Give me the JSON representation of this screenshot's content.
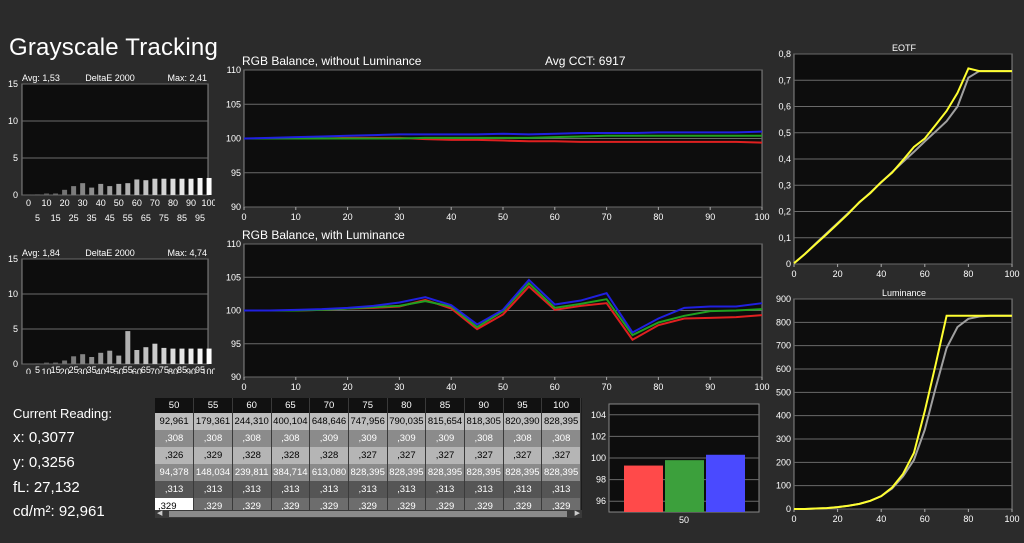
{
  "page": {
    "title": "Grayscale Tracking"
  },
  "readout": {
    "label": "Current Reading:",
    "x": "x: 0,3077",
    "y": "y: 0,3256",
    "fl": "fL: 27,132",
    "cdm2": "cd/m²: 92,961"
  },
  "colors": {
    "background": "#2b2b2b",
    "plot_bg": "#0d0d0d",
    "grid": "#6a6a6a",
    "red": "#e02020",
    "green": "#20a020",
    "blue": "#2020e0",
    "yellow": "#ffff30",
    "gray_line": "#a0a0a0"
  },
  "table": {
    "headers": [
      "50",
      "55",
      "60",
      "65",
      "70",
      "75",
      "80",
      "85",
      "90",
      "95",
      "100"
    ],
    "rows": [
      [
        "92,961",
        "179,361",
        "244,310",
        "400,104",
        "648,646",
        "747,956",
        "790,035",
        "815,654",
        "818,305",
        "820,390",
        "828,395"
      ],
      [
        ",308",
        ",308",
        ",308",
        ",308",
        ",309",
        ",309",
        ",309",
        ",309",
        ",308",
        ",308",
        ",308"
      ],
      [
        ",326",
        ",329",
        ",328",
        ",328",
        ",328",
        ",327",
        ",327",
        ",327",
        ",327",
        ",327",
        ",327"
      ],
      [
        "94,378",
        "148,034",
        "239,811",
        "384,714",
        "613,080",
        "828,395",
        "828,395",
        "828,395",
        "828,395",
        "828,395",
        "828,395"
      ],
      [
        ",313",
        ",313",
        ",313",
        ",313",
        ",313",
        ",313",
        ",313",
        ",313",
        ",313",
        ",313",
        ",313"
      ],
      [
        ",329",
        ",329",
        ",329",
        ",329",
        ",329",
        ",329",
        ",329",
        ",329",
        ",329",
        ",329",
        ",329"
      ]
    ],
    "scroll_left": "◀",
    "scroll_right": "▶"
  },
  "chart_data": [
    {
      "id": "delta-e-top",
      "type": "bar",
      "title": "DeltaE 2000",
      "avg_label": "Avg: 1,53",
      "max_label": "Max: 2,41",
      "categories": [
        0,
        5,
        10,
        15,
        20,
        25,
        30,
        35,
        40,
        45,
        50,
        55,
        60,
        65,
        70,
        75,
        80,
        85,
        90,
        95,
        100
      ],
      "values": [
        0.1,
        0.1,
        0.2,
        0.2,
        0.7,
        1.2,
        1.6,
        1.0,
        1.5,
        1.2,
        1.5,
        1.6,
        2.1,
        2.0,
        2.2,
        2.2,
        2.2,
        2.2,
        2.2,
        2.3,
        2.3
      ],
      "ylim": [
        0,
        15
      ],
      "yticks": [
        0,
        5,
        10,
        15
      ],
      "xticks_upper": [
        "0",
        "10",
        "20",
        "30",
        "40",
        "50",
        "60",
        "70",
        "80",
        "90",
        "100"
      ],
      "xticks_lower": [
        "5",
        "15",
        "25",
        "35",
        "45",
        "55",
        "65",
        "75",
        "85",
        "95"
      ]
    },
    {
      "id": "delta-e-bottom",
      "type": "bar",
      "title": "DeltaE 2000",
      "avg_label": "Avg: 1,84",
      "max_label": "Max: 4,74",
      "categories": [
        0,
        5,
        10,
        15,
        20,
        25,
        30,
        35,
        40,
        45,
        50,
        55,
        60,
        65,
        70,
        75,
        80,
        85,
        90,
        95,
        100
      ],
      "values": [
        0.1,
        0.1,
        0.2,
        0.2,
        0.5,
        1.1,
        1.4,
        1.0,
        1.6,
        1.9,
        1.2,
        4.7,
        2.0,
        2.4,
        2.9,
        2.3,
        2.2,
        2.2,
        2.2,
        2.2,
        2.2
      ],
      "ylim": [
        0,
        15
      ],
      "yticks": [
        0,
        5,
        10,
        15
      ],
      "xticks": [
        "0",
        "10",
        "20",
        "30",
        "40",
        "50",
        "60",
        "70",
        "80",
        "90",
        "100"
      ],
      "xticks_mid": [
        "5",
        "15",
        "25",
        "35",
        "45",
        "55",
        "65",
        "75",
        "85",
        "95"
      ]
    },
    {
      "id": "rgb-balance-no-lum",
      "type": "line",
      "title": "RGB Balance, without Luminance",
      "extra_label": "Avg CCT: 6917",
      "x": [
        0,
        5,
        10,
        15,
        20,
        25,
        30,
        35,
        40,
        45,
        50,
        55,
        60,
        65,
        70,
        75,
        80,
        85,
        90,
        95,
        100
      ],
      "series": [
        {
          "color": "red",
          "values": [
            100,
            100,
            100,
            100,
            100.1,
            100.1,
            100.1,
            99.9,
            99.8,
            99.8,
            99.7,
            99.6,
            99.6,
            99.5,
            99.5,
            99.5,
            99.5,
            99.5,
            99.5,
            99.5,
            99.4
          ]
        },
        {
          "color": "green",
          "values": [
            100,
            100,
            100,
            100,
            100,
            100,
            100,
            100.1,
            100.1,
            100.1,
            100.1,
            100.1,
            100.2,
            100.3,
            100.4,
            100.4,
            100.4,
            100.4,
            100.4,
            100.4,
            100.4
          ]
        },
        {
          "color": "blue",
          "values": [
            100,
            100.1,
            100.2,
            100.3,
            100.4,
            100.5,
            100.6,
            100.6,
            100.6,
            100.6,
            100.7,
            100.6,
            100.7,
            100.8,
            100.8,
            100.8,
            100.9,
            100.9,
            100.9,
            100.9,
            101.0
          ]
        }
      ],
      "xlim": [
        0,
        100
      ],
      "ylim": [
        90,
        110
      ],
      "xticks": [
        0,
        10,
        20,
        30,
        40,
        50,
        60,
        70,
        80,
        90,
        100
      ],
      "yticks": [
        90,
        95,
        100,
        105,
        110
      ]
    },
    {
      "id": "rgb-balance-lum",
      "type": "line",
      "title": "RGB Balance, with Luminance",
      "x": [
        0,
        5,
        10,
        15,
        20,
        25,
        30,
        35,
        40,
        45,
        50,
        55,
        60,
        65,
        70,
        75,
        80,
        85,
        90,
        95,
        100
      ],
      "series": [
        {
          "color": "red",
          "values": [
            100,
            100,
            100,
            100.1,
            100.3,
            100.4,
            100.6,
            101.6,
            100.3,
            97.2,
            99.4,
            103.6,
            100.1,
            100.7,
            101.1,
            95.6,
            97.8,
            98.8,
            98.9,
            99.0,
            99.3
          ]
        },
        {
          "color": "green",
          "values": [
            100,
            100,
            100,
            100.1,
            100.3,
            100.5,
            100.7,
            101.4,
            100.6,
            97.5,
            99.9,
            104.1,
            100.4,
            101.0,
            101.7,
            96.3,
            98.2,
            99.2,
            99.9,
            100.0,
            100.2
          ]
        },
        {
          "color": "blue",
          "values": [
            100,
            100,
            100.1,
            100.2,
            100.4,
            100.7,
            101.2,
            102.0,
            100.8,
            97.9,
            100.1,
            104.6,
            100.9,
            101.5,
            102.6,
            96.7,
            98.8,
            100.4,
            100.6,
            100.6,
            101.1
          ]
        }
      ],
      "xlim": [
        0,
        100
      ],
      "ylim": [
        90,
        110
      ],
      "xticks": [
        0,
        10,
        20,
        30,
        40,
        50,
        60,
        70,
        80,
        90,
        100
      ],
      "yticks": [
        90,
        95,
        100,
        105,
        110
      ]
    },
    {
      "id": "rgb-bars",
      "type": "bar",
      "categories": [
        "50"
      ],
      "series": [
        {
          "color": "red",
          "value": 99.3
        },
        {
          "color": "green",
          "value": 99.8
        },
        {
          "color": "blue",
          "value": 100.3
        }
      ],
      "ylim": [
        95,
        105
      ],
      "yticks": [
        96,
        98,
        100,
        102,
        104
      ],
      "xlabel": "50"
    },
    {
      "id": "eotf",
      "type": "line",
      "title": "EOTF",
      "x": [
        0,
        5,
        10,
        15,
        20,
        25,
        30,
        35,
        40,
        45,
        50,
        55,
        60,
        65,
        70,
        75,
        80,
        85,
        90,
        95,
        100
      ],
      "series": [
        {
          "color": "gray_line",
          "values": [
            0.003,
            0.038,
            0.078,
            0.117,
            0.156,
            0.195,
            0.234,
            0.272,
            0.311,
            0.35,
            0.389,
            0.427,
            0.467,
            0.505,
            0.544,
            0.6,
            0.71,
            0.735,
            0.735,
            0.735,
            0.735
          ]
        },
        {
          "color": "yellow",
          "values": [
            0.003,
            0.038,
            0.076,
            0.114,
            0.153,
            0.192,
            0.236,
            0.27,
            0.312,
            0.348,
            0.396,
            0.446,
            0.478,
            0.53,
            0.583,
            0.652,
            0.745,
            0.735,
            0.735,
            0.735,
            0.735
          ]
        }
      ],
      "xlim": [
        0,
        100
      ],
      "ylim": [
        0,
        0.8
      ],
      "xticks": [
        0,
        20,
        40,
        60,
        80,
        100
      ],
      "yticks": [
        "0",
        "0,1",
        "0,2",
        "0,3",
        "0,4",
        "0,5",
        "0,6",
        "0,7",
        "0,8"
      ]
    },
    {
      "id": "luminance",
      "type": "line",
      "title": "Luminance",
      "x": [
        0,
        5,
        10,
        15,
        20,
        25,
        30,
        35,
        40,
        45,
        50,
        55,
        60,
        65,
        70,
        75,
        80,
        85,
        90,
        95,
        100
      ],
      "series": [
        {
          "color": "gray_line",
          "values": [
            0,
            0,
            2,
            4,
            8,
            14,
            22,
            35,
            55,
            88,
            140,
            210,
            340,
            520,
            690,
            780,
            815,
            825,
            828,
            828,
            828
          ]
        },
        {
          "color": "yellow",
          "values": [
            0,
            0,
            2,
            4,
            8,
            14,
            22,
            35,
            55,
            92,
            150,
            240,
            420,
            620,
            828,
            828,
            828,
            828,
            828,
            828,
            828
          ]
        }
      ],
      "xlim": [
        0,
        100
      ],
      "ylim": [
        0,
        900
      ],
      "xticks": [
        0,
        20,
        40,
        60,
        80,
        100
      ],
      "yticks": [
        0,
        100,
        200,
        300,
        400,
        500,
        600,
        700,
        800,
        900
      ]
    }
  ]
}
